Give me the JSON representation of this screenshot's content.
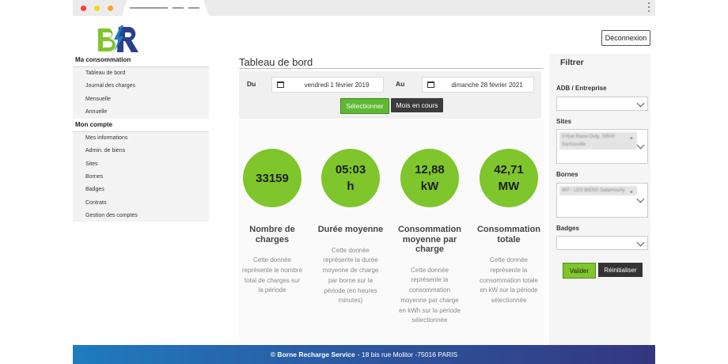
{
  "colors": {
    "accent_green": "#7fc52c",
    "dark_button": "#3b3b3b",
    "footer_start": "#1f7bbf",
    "footer_end": "#34367f"
  },
  "header": {
    "logo": "BR",
    "logout_label": "Déconnexion"
  },
  "sidebar": {
    "sections": [
      {
        "title": "Ma consommation",
        "items": [
          "Tableau de bord",
          "Journal des charges",
          "Mensuelle",
          "Annuelle"
        ]
      },
      {
        "title": "Mon compte",
        "items": [
          "Mes informations",
          "Admin. de biens",
          "Sites",
          "Bornes",
          "Badges",
          "Contrats",
          "Gestion des comptes"
        ]
      }
    ]
  },
  "main": {
    "title": "Tableau de bord",
    "filter": {
      "from_label": "Du",
      "from_value": "vendredi 1 février 2019",
      "to_label": "Au",
      "to_value": "dimanche 28 février 2021",
      "select_label": "Sélectionner",
      "current_month_label": "Mois en cours"
    },
    "stats": [
      {
        "value": "33159",
        "unit": "",
        "title": "Nombre de charges",
        "desc": "Cette donnée représente le nombre total de charges sur la période"
      },
      {
        "value": "05:03",
        "unit": "h",
        "title": "Durée moyenne",
        "desc": "Cette donnée représente la durée moyenne de charge par borne sur la période (en heures minutes)"
      },
      {
        "value": "12,88",
        "unit": "kW",
        "title": "Consommation moyenne par charge",
        "desc": "Cette donnée représente la consommation moyenne par charge en kWh sur la période sélectionnée"
      },
      {
        "value": "42,71",
        "unit": "MW",
        "title": "Consommation totale",
        "desc": "Cette donnée représente la consommation totale en kW sur la période sélectionnée"
      }
    ]
  },
  "filters_panel": {
    "title": "Filtrer",
    "adb_label": "ADB / Entreprise",
    "sites_label": "Sites",
    "sites_tag": "3 Rue Raoul Dufy, 78500 Sartrouville",
    "bornes_label": "Bornes",
    "bornes_tag": "497 - LES BIENS Sallamourty",
    "badges_label": "Badges",
    "apply_label": "Valider",
    "reset_label": "Réinitialiser"
  },
  "footer": {
    "brand": "© Borne Recharge Service",
    "address": "- 18 bis rue Molitor -75016 PARIS"
  }
}
